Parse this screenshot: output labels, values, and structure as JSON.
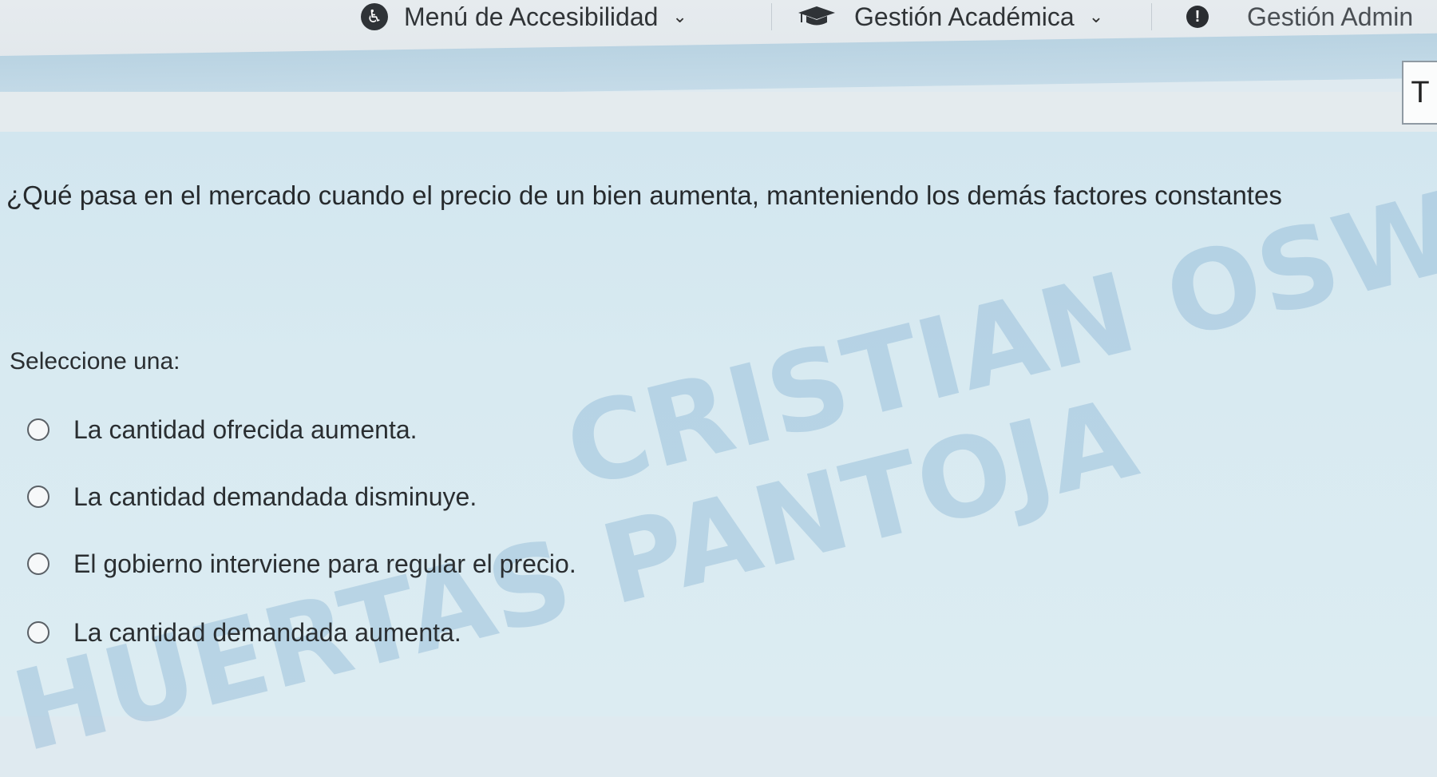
{
  "topbar": {
    "menus": [
      {
        "label": "Menú de Accesibilidad",
        "icon": "accessibility-icon"
      },
      {
        "label": "Gestión Académica",
        "icon": "graduation-cap-icon"
      },
      {
        "label": "Gestión Admin",
        "icon": "info-icon"
      }
    ],
    "text_tool_label": "T"
  },
  "question": {
    "text": "¿Qué pasa en el mercado cuando el precio de un bien aumenta, manteniendo los demás factores constantes",
    "prompt": "Seleccione una:",
    "options": [
      "La cantidad ofrecida aumenta.",
      "La cantidad demandada disminuye.",
      "El gobierno interviene para regular el precio.",
      "La cantidad demandada aumenta."
    ]
  },
  "watermark": {
    "line1": "CRISTIAN OSWALDO",
    "line2": "HUERTAS PANTOJA"
  }
}
